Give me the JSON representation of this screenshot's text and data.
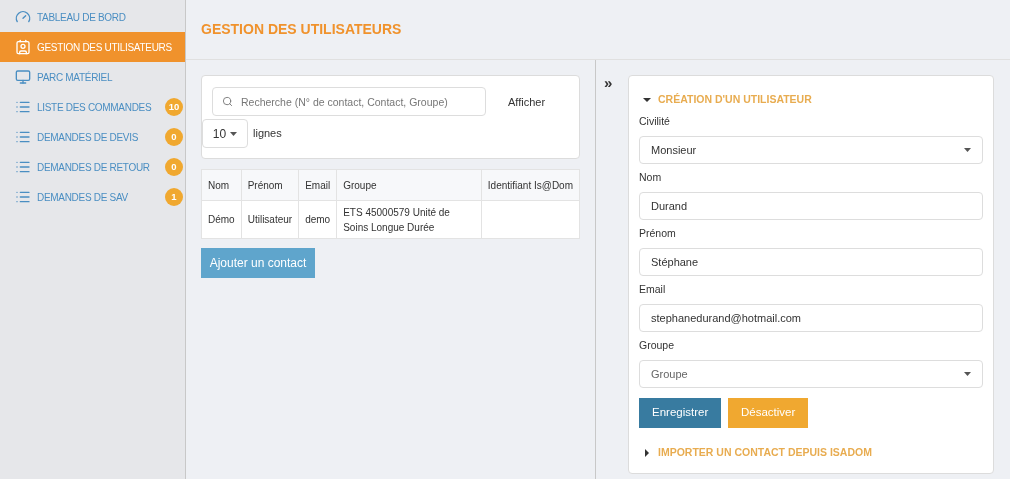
{
  "sidebar": {
    "items": [
      {
        "label": "TABLEAU DE BORD",
        "kind": "gauge",
        "selected": false
      },
      {
        "label": "GESTION DES UTILISATEURS",
        "kind": "contact",
        "selected": true
      },
      {
        "label": "PARC MATÉRIEL",
        "kind": "monitor",
        "selected": false
      },
      {
        "label": "LISTE DES COMMANDES",
        "kind": "list",
        "selected": false,
        "badge": "10"
      },
      {
        "label": "DEMANDES DE DEVIS",
        "kind": "list",
        "selected": false,
        "badge": "0"
      },
      {
        "label": "DEMANDES DE RETOUR",
        "kind": "list",
        "selected": false,
        "badge": "0"
      },
      {
        "label": "DEMANDES DE SAV",
        "kind": "list",
        "selected": false,
        "badge": "1"
      }
    ]
  },
  "page_title": "GESTION DES UTILISATEURS",
  "search": {
    "placeholder": "Recherche (N° de contact, Contact, Groupe)",
    "show_label": "Afficher",
    "page_size": "10",
    "page_size_suffix": "lignes"
  },
  "table": {
    "columns": [
      "Nom",
      "Prénom",
      "Email",
      "Groupe",
      "Identifiant Is@Dom"
    ],
    "rows": [
      [
        "Démo",
        "Utilisateur",
        "demo",
        "ETS 45000579 Unité de Soins Longue Durée",
        ""
      ]
    ]
  },
  "add_button": "Ajouter un contact",
  "collapse_toggle": "»",
  "form": {
    "title": "CRÉATION D'UN UTILISATEUR",
    "expanded": true,
    "fields": [
      {
        "label": "Civilité",
        "kind": "select",
        "value": "Monsieur"
      },
      {
        "label": "Nom",
        "kind": "text",
        "value": "Durand"
      },
      {
        "label": "Prénom",
        "kind": "text",
        "value": "Stéphane"
      },
      {
        "label": "Email",
        "kind": "text",
        "value": "stephanedurand@hotmail.com"
      },
      {
        "label": "Groupe",
        "kind": "select",
        "placeholder": "Groupe"
      }
    ],
    "buttons": [
      {
        "label": "Enregistrer",
        "kind": "primary"
      },
      {
        "label": "Désactiver",
        "kind": "warning"
      }
    ]
  },
  "import_section": {
    "title": "IMPORTER UN CONTACT DEPUIS ISADOM",
    "expanded": false
  }
}
